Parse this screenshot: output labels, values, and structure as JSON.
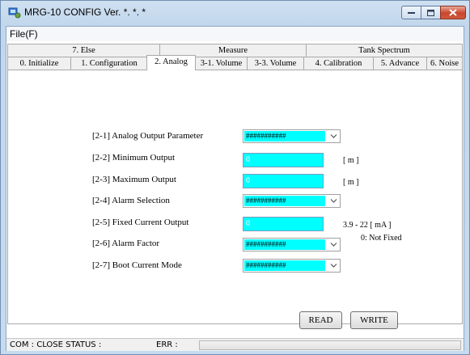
{
  "window": {
    "title": "MRG-10 CONFIG Ver. *. *. *"
  },
  "menu": {
    "file": "File(F)"
  },
  "tabs_top": [
    {
      "label": "7. Else"
    },
    {
      "label": "Measure"
    },
    {
      "label": "Tank Spectrum"
    }
  ],
  "tabs_bottom": [
    {
      "label": "0. Initialize"
    },
    {
      "label": "1. Configuration"
    },
    {
      "label": "2. Analog",
      "active": true
    },
    {
      "label": "3-1. Volume"
    },
    {
      "label": "3-3. Volume"
    },
    {
      "label": "4. Calibration"
    },
    {
      "label": "5. Advance"
    },
    {
      "label": "6. Noise"
    }
  ],
  "analog": {
    "output_param": {
      "label": "[2-1] Analog Output Parameter",
      "value": "###########"
    },
    "min_output": {
      "label": "[2-2] Minimum Output",
      "value": "0",
      "unit": "[ m ]"
    },
    "max_output": {
      "label": "[2-3] Maximum Output",
      "value": "0",
      "unit": "[ m ]"
    },
    "alarm_selection": {
      "label": "[2-4] Alarm Selection",
      "value": "###########"
    },
    "fixed_current": {
      "label": "[2-5] Fixed Current Output",
      "value": "0",
      "range": "3.9 - 22 [ mA ]",
      "note": "0: Not Fixed"
    },
    "alarm_factor": {
      "label": "[2-6] Alarm Factor",
      "value": "###########"
    },
    "boot_current": {
      "label": "[2-7] Boot Current Mode",
      "value": "###########"
    }
  },
  "buttons": {
    "read": "READ",
    "write": "WRITE"
  },
  "status": {
    "com": "COM : CLOSE STATUS :",
    "err": "ERR :"
  },
  "colors": {
    "field_fill": "#00ffff",
    "close_button": "#c9462c"
  }
}
